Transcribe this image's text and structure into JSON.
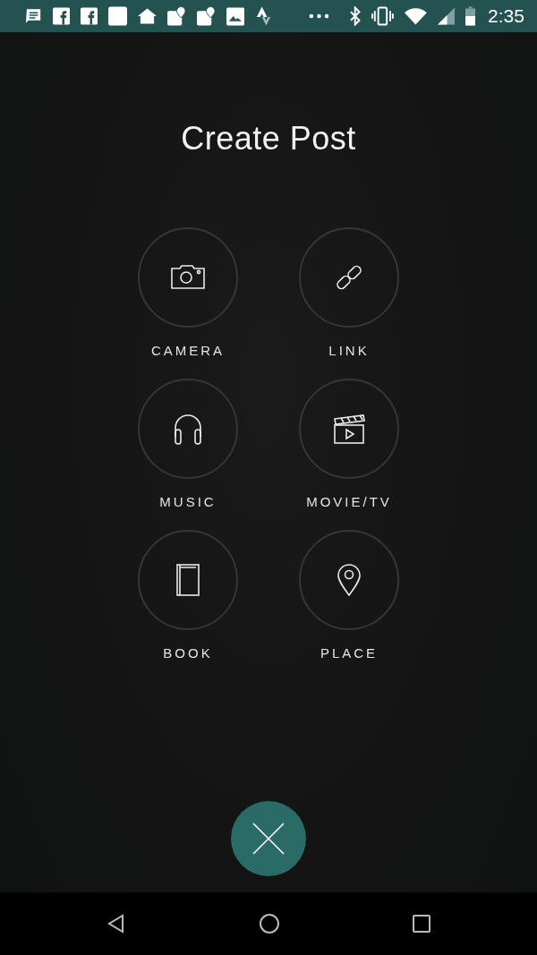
{
  "status_bar": {
    "time": "2:35"
  },
  "title": "Create Post",
  "options": [
    {
      "kind": "camera",
      "label": "CAMERA"
    },
    {
      "kind": "link",
      "label": "LINK"
    },
    {
      "kind": "music",
      "label": "MUSIC"
    },
    {
      "kind": "movie",
      "label": "MOVIE/TV"
    },
    {
      "kind": "book",
      "label": "BOOK"
    },
    {
      "kind": "place",
      "label": "PLACE"
    }
  ]
}
